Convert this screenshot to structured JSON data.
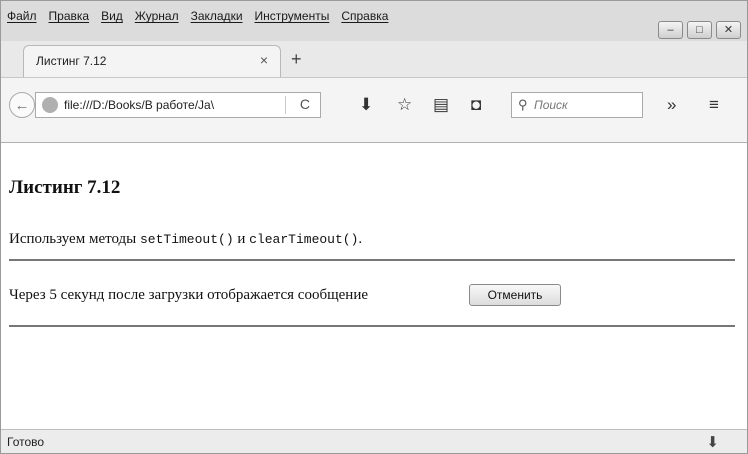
{
  "menu": [
    "Файл",
    "Правка",
    "Вид",
    "Журнал",
    "Закладки",
    "Инструменты",
    "Справка"
  ],
  "window_controls": {
    "minimize_icon": "minimize-icon",
    "maximize_icon": "maximize-icon",
    "close_icon": "close-icon"
  },
  "tab": {
    "title": "Листинг 7.12",
    "close_glyph": "×",
    "new_tab_glyph": "+"
  },
  "navbar": {
    "url": "file:///D:/Books/В работе/Ja\\",
    "reload_glyph": "C",
    "search_placeholder": "Поиск",
    "overflow_glyph": "»",
    "menu_glyph": "≡"
  },
  "page": {
    "heading": "Листинг 7.12",
    "intro_prefix": "Используем методы ",
    "code1": "setTimeout()",
    "intro_mid": " и ",
    "code2": "clearTimeout()",
    "intro_suffix": ".",
    "message": "Через 5 секунд после загрузки отображается сообщение",
    "cancel_label": "Отменить"
  },
  "status": {
    "text": "Готово"
  }
}
